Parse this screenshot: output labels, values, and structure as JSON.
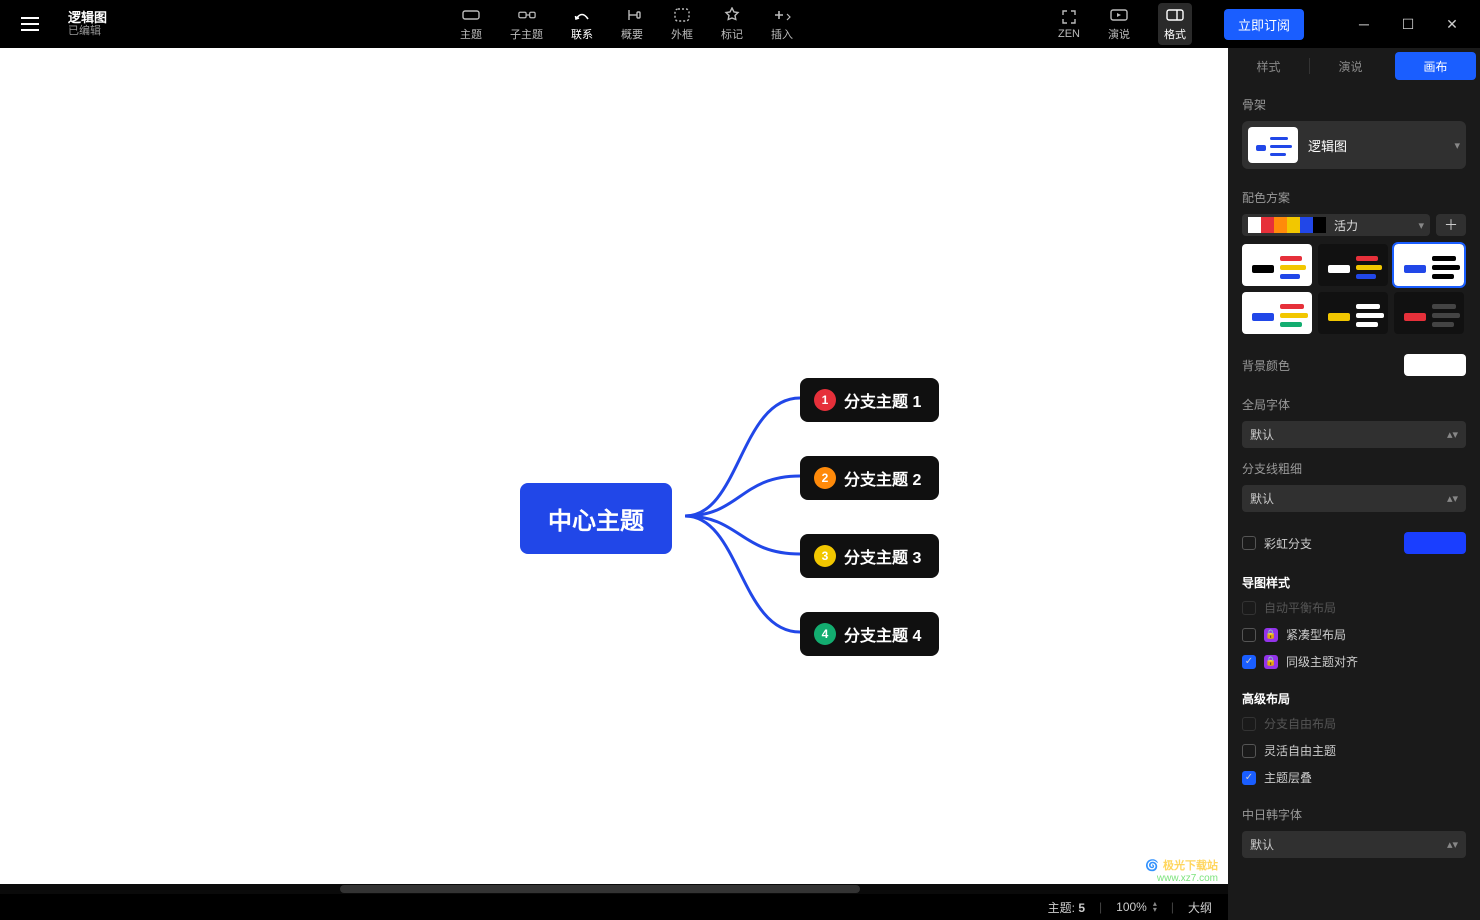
{
  "header": {
    "doc_title": "逻辑图",
    "doc_status": "已编辑",
    "toolbar": [
      {
        "id": "theme",
        "label": "主题"
      },
      {
        "id": "subtopic",
        "label": "子主题"
      },
      {
        "id": "relation",
        "label": "联系",
        "active": true
      },
      {
        "id": "summary",
        "label": "概要"
      },
      {
        "id": "boundary",
        "label": "外框"
      },
      {
        "id": "marker",
        "label": "标记"
      },
      {
        "id": "insert",
        "label": "插入"
      }
    ],
    "right_tools": [
      {
        "id": "zen",
        "label": "ZEN"
      },
      {
        "id": "pitch",
        "label": "演说"
      },
      {
        "id": "format",
        "label": "格式",
        "active": true
      }
    ],
    "subscribe": "立即订阅"
  },
  "canvas": {
    "central": "中心主题",
    "branches": [
      {
        "num": "1",
        "label": "分支主题 1",
        "color": "#e6303a"
      },
      {
        "num": "2",
        "label": "分支主题 2",
        "color": "#ff8a0a"
      },
      {
        "num": "3",
        "label": "分支主题 3",
        "color": "#f2c700"
      },
      {
        "num": "4",
        "label": "分支主题 4",
        "color": "#13ad70"
      }
    ]
  },
  "panel": {
    "tabs": {
      "style": "样式",
      "pitch": "演说",
      "canvas": "画布"
    },
    "structure": {
      "label": "骨架",
      "name": "逻辑图"
    },
    "scheme": {
      "label": "配色方案",
      "name": "活力",
      "colors": [
        "#ffffff",
        "#e6303a",
        "#ff8a0a",
        "#f2c700",
        "#2147e8",
        "#000000"
      ]
    },
    "bg": {
      "label": "背景颜色",
      "value": "#ffffff"
    },
    "global_font": {
      "label": "全局字体",
      "value": "默认"
    },
    "branch_width": {
      "label": "分支线粗细",
      "value": "默认"
    },
    "rainbow": {
      "label": "彩虹分支",
      "swatch": "#2a3bff"
    },
    "map_style": {
      "label": "导图样式",
      "auto_balance": "自动平衡布局",
      "compact": "紧凑型布局",
      "align_siblings": "同级主题对齐"
    },
    "advanced": {
      "label": "高级布局",
      "free_branch": "分支自由布局",
      "free_topic": "灵活自由主题",
      "overlap": "主题层叠"
    },
    "cjk_font": {
      "label": "中日韩字体",
      "value": "默认"
    }
  },
  "status": {
    "topics_label": "主题:",
    "topics_count": "5",
    "zoom": "100%",
    "outline": "大纲"
  },
  "watermark": {
    "title": "极光下载站",
    "url": "www.xz7.com"
  }
}
